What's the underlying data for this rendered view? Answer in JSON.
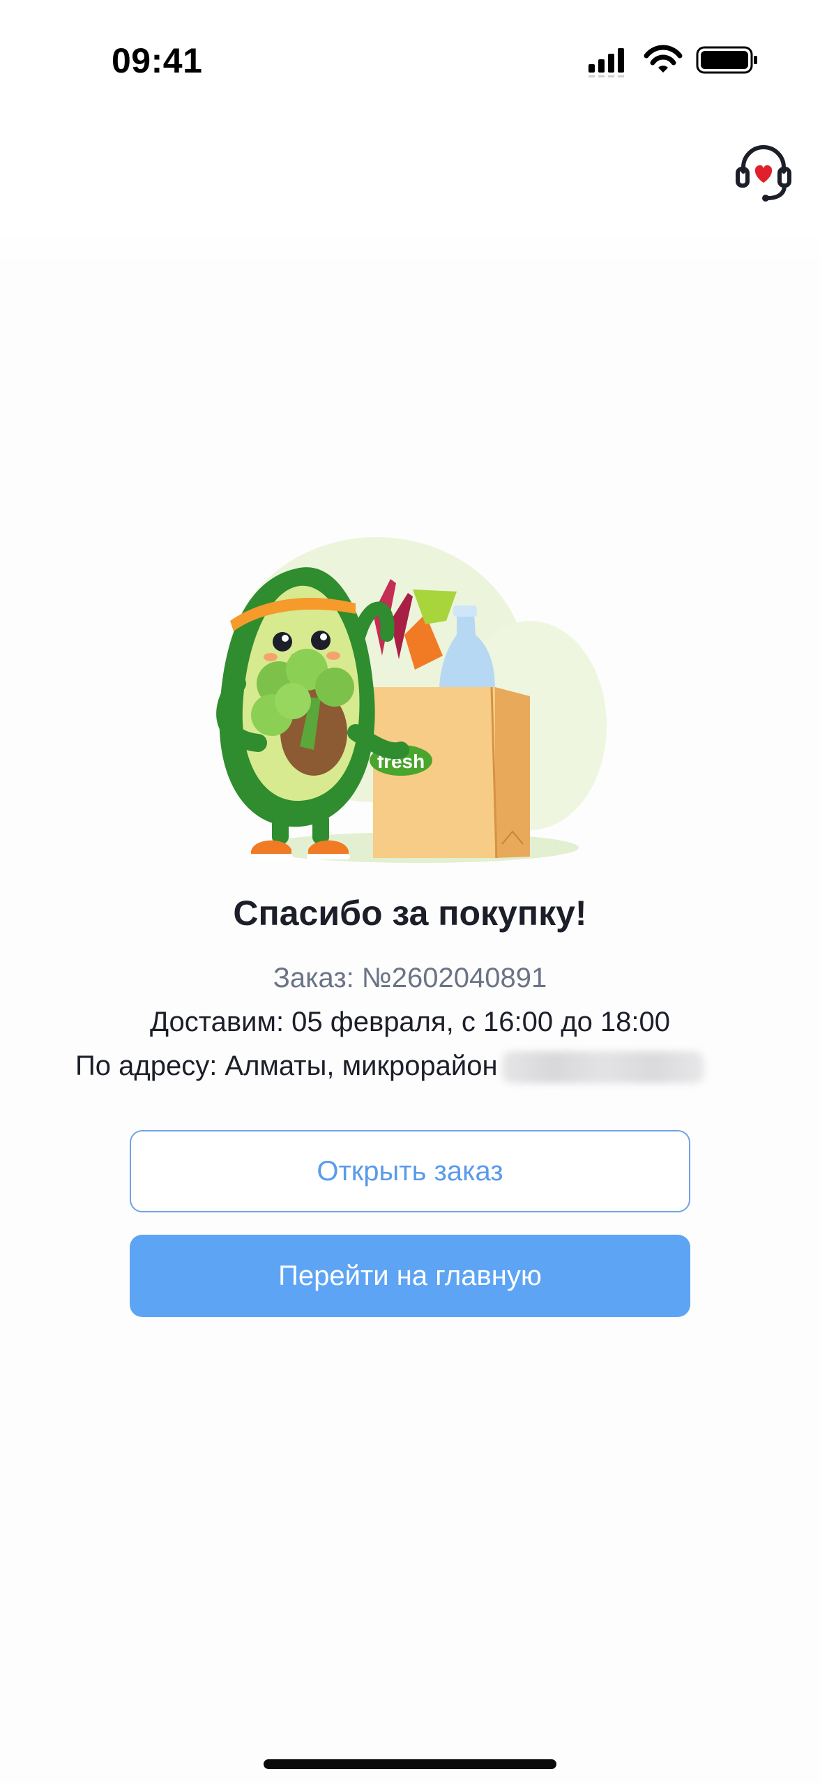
{
  "status_bar": {
    "time": "09:41"
  },
  "header": {
    "support_icon": "support-headset-heart-icon",
    "accent_color": "#e0202a"
  },
  "illustration": {
    "icon": "avocado-mascot-grocery-bag-illustration",
    "bag_logo": "fresh"
  },
  "confirmation": {
    "title": "Спасибо за покупку!",
    "order_number": "Заказ: №2602040891",
    "delivery": "Доставим: 05 февраля, с 16:00 до 18:00",
    "address_prefix": "По адресу: Алматы, микрорайон"
  },
  "actions": {
    "open_order_label": "Открыть заказ",
    "home_label": "Перейти на главную",
    "primary_color": "#5ea4f4"
  }
}
